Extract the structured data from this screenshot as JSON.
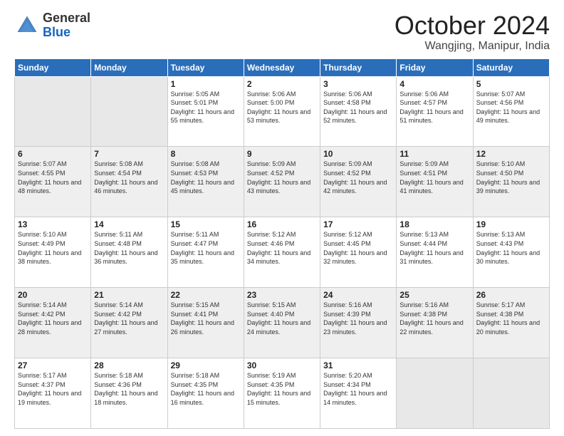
{
  "header": {
    "logo_general": "General",
    "logo_blue": "Blue",
    "month": "October 2024",
    "location": "Wangjing, Manipur, India"
  },
  "weekdays": [
    "Sunday",
    "Monday",
    "Tuesday",
    "Wednesday",
    "Thursday",
    "Friday",
    "Saturday"
  ],
  "weeks": [
    [
      {
        "day": "",
        "empty": true
      },
      {
        "day": "",
        "empty": true
      },
      {
        "day": "1",
        "sunrise": "Sunrise: 5:05 AM",
        "sunset": "Sunset: 5:01 PM",
        "daylight": "Daylight: 11 hours and 55 minutes."
      },
      {
        "day": "2",
        "sunrise": "Sunrise: 5:06 AM",
        "sunset": "Sunset: 5:00 PM",
        "daylight": "Daylight: 11 hours and 53 minutes."
      },
      {
        "day": "3",
        "sunrise": "Sunrise: 5:06 AM",
        "sunset": "Sunset: 4:58 PM",
        "daylight": "Daylight: 11 hours and 52 minutes."
      },
      {
        "day": "4",
        "sunrise": "Sunrise: 5:06 AM",
        "sunset": "Sunset: 4:57 PM",
        "daylight": "Daylight: 11 hours and 51 minutes."
      },
      {
        "day": "5",
        "sunrise": "Sunrise: 5:07 AM",
        "sunset": "Sunset: 4:56 PM",
        "daylight": "Daylight: 11 hours and 49 minutes."
      }
    ],
    [
      {
        "day": "6",
        "sunrise": "Sunrise: 5:07 AM",
        "sunset": "Sunset: 4:55 PM",
        "daylight": "Daylight: 11 hours and 48 minutes."
      },
      {
        "day": "7",
        "sunrise": "Sunrise: 5:08 AM",
        "sunset": "Sunset: 4:54 PM",
        "daylight": "Daylight: 11 hours and 46 minutes."
      },
      {
        "day": "8",
        "sunrise": "Sunrise: 5:08 AM",
        "sunset": "Sunset: 4:53 PM",
        "daylight": "Daylight: 11 hours and 45 minutes."
      },
      {
        "day": "9",
        "sunrise": "Sunrise: 5:09 AM",
        "sunset": "Sunset: 4:52 PM",
        "daylight": "Daylight: 11 hours and 43 minutes."
      },
      {
        "day": "10",
        "sunrise": "Sunrise: 5:09 AM",
        "sunset": "Sunset: 4:52 PM",
        "daylight": "Daylight: 11 hours and 42 minutes."
      },
      {
        "day": "11",
        "sunrise": "Sunrise: 5:09 AM",
        "sunset": "Sunset: 4:51 PM",
        "daylight": "Daylight: 11 hours and 41 minutes."
      },
      {
        "day": "12",
        "sunrise": "Sunrise: 5:10 AM",
        "sunset": "Sunset: 4:50 PM",
        "daylight": "Daylight: 11 hours and 39 minutes."
      }
    ],
    [
      {
        "day": "13",
        "sunrise": "Sunrise: 5:10 AM",
        "sunset": "Sunset: 4:49 PM",
        "daylight": "Daylight: 11 hours and 38 minutes."
      },
      {
        "day": "14",
        "sunrise": "Sunrise: 5:11 AM",
        "sunset": "Sunset: 4:48 PM",
        "daylight": "Daylight: 11 hours and 36 minutes."
      },
      {
        "day": "15",
        "sunrise": "Sunrise: 5:11 AM",
        "sunset": "Sunset: 4:47 PM",
        "daylight": "Daylight: 11 hours and 35 minutes."
      },
      {
        "day": "16",
        "sunrise": "Sunrise: 5:12 AM",
        "sunset": "Sunset: 4:46 PM",
        "daylight": "Daylight: 11 hours and 34 minutes."
      },
      {
        "day": "17",
        "sunrise": "Sunrise: 5:12 AM",
        "sunset": "Sunset: 4:45 PM",
        "daylight": "Daylight: 11 hours and 32 minutes."
      },
      {
        "day": "18",
        "sunrise": "Sunrise: 5:13 AM",
        "sunset": "Sunset: 4:44 PM",
        "daylight": "Daylight: 11 hours and 31 minutes."
      },
      {
        "day": "19",
        "sunrise": "Sunrise: 5:13 AM",
        "sunset": "Sunset: 4:43 PM",
        "daylight": "Daylight: 11 hours and 30 minutes."
      }
    ],
    [
      {
        "day": "20",
        "sunrise": "Sunrise: 5:14 AM",
        "sunset": "Sunset: 4:42 PM",
        "daylight": "Daylight: 11 hours and 28 minutes."
      },
      {
        "day": "21",
        "sunrise": "Sunrise: 5:14 AM",
        "sunset": "Sunset: 4:42 PM",
        "daylight": "Daylight: 11 hours and 27 minutes."
      },
      {
        "day": "22",
        "sunrise": "Sunrise: 5:15 AM",
        "sunset": "Sunset: 4:41 PM",
        "daylight": "Daylight: 11 hours and 26 minutes."
      },
      {
        "day": "23",
        "sunrise": "Sunrise: 5:15 AM",
        "sunset": "Sunset: 4:40 PM",
        "daylight": "Daylight: 11 hours and 24 minutes."
      },
      {
        "day": "24",
        "sunrise": "Sunrise: 5:16 AM",
        "sunset": "Sunset: 4:39 PM",
        "daylight": "Daylight: 11 hours and 23 minutes."
      },
      {
        "day": "25",
        "sunrise": "Sunrise: 5:16 AM",
        "sunset": "Sunset: 4:38 PM",
        "daylight": "Daylight: 11 hours and 22 minutes."
      },
      {
        "day": "26",
        "sunrise": "Sunrise: 5:17 AM",
        "sunset": "Sunset: 4:38 PM",
        "daylight": "Daylight: 11 hours and 20 minutes."
      }
    ],
    [
      {
        "day": "27",
        "sunrise": "Sunrise: 5:17 AM",
        "sunset": "Sunset: 4:37 PM",
        "daylight": "Daylight: 11 hours and 19 minutes."
      },
      {
        "day": "28",
        "sunrise": "Sunrise: 5:18 AM",
        "sunset": "Sunset: 4:36 PM",
        "daylight": "Daylight: 11 hours and 18 minutes."
      },
      {
        "day": "29",
        "sunrise": "Sunrise: 5:18 AM",
        "sunset": "Sunset: 4:35 PM",
        "daylight": "Daylight: 11 hours and 16 minutes."
      },
      {
        "day": "30",
        "sunrise": "Sunrise: 5:19 AM",
        "sunset": "Sunset: 4:35 PM",
        "daylight": "Daylight: 11 hours and 15 minutes."
      },
      {
        "day": "31",
        "sunrise": "Sunrise: 5:20 AM",
        "sunset": "Sunset: 4:34 PM",
        "daylight": "Daylight: 11 hours and 14 minutes."
      },
      {
        "day": "",
        "empty": true
      },
      {
        "day": "",
        "empty": true
      }
    ]
  ]
}
